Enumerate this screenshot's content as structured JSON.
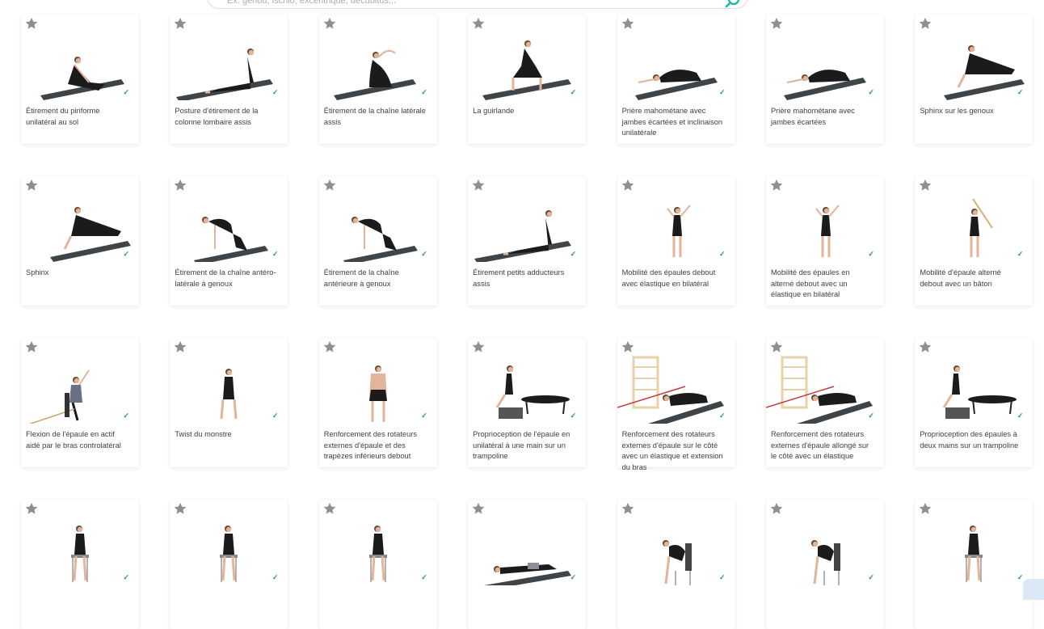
{
  "search": {
    "placeholder": "Ex. genou, ischio, excentrique, décubitus..."
  },
  "check_mark": "✓",
  "exercises": [
    {
      "title": "Étirement du piriforme unilatéral au sol",
      "pose": "mat-lie"
    },
    {
      "title": "Posture d'étirement de la colonne lombaire assis",
      "pose": "mat-sit"
    },
    {
      "title": "Étirement de la chaîne latérale assis",
      "pose": "mat-side"
    },
    {
      "title": "La guirlande",
      "pose": "mat-squat"
    },
    {
      "title": "Prière mahométane avec jambes écartées et inclinaison unilatérale",
      "pose": "mat-child"
    },
    {
      "title": "Prière mahométane avec jambes écartées",
      "pose": "mat-child"
    },
    {
      "title": "Sphinx sur les genoux",
      "pose": "mat-sphinx"
    },
    {
      "title": "Sphinx",
      "pose": "mat-sphinx"
    },
    {
      "title": "Étirement de la chaîne antéro-latérale à genoux",
      "pose": "mat-arch"
    },
    {
      "title": "Étirement de la chaîne antérieure à genoux",
      "pose": "mat-arch"
    },
    {
      "title": "Étirement petits adducteurs assis",
      "pose": "mat-sit"
    },
    {
      "title": "Mobilité des épaules debout avec élastique en bilatéral",
      "pose": "stand-arms"
    },
    {
      "title": "Mobilité des épaules en alterné debout avec un élastique en bilatéral",
      "pose": "stand-arms"
    },
    {
      "title": "Mobilité d'épaule alterné debout avec un bâton",
      "pose": "stand-stick"
    },
    {
      "title": "Flexion de l'épaule en actif aidé par le bras controlatéral",
      "pose": "chair-arm"
    },
    {
      "title": "Twist du monstre",
      "pose": "stand"
    },
    {
      "title": "Renforcement des rotateurs externes d'épaule et des trapèzes inférieurs debout",
      "pose": "stand-back"
    },
    {
      "title": "Proprioception de l'épaule en unilatéral à une main sur un trampoline",
      "pose": "trampoline"
    },
    {
      "title": "Renforcement des rotateurs externes d'épaule sur le côté avec un élastique et extension du bras",
      "pose": "wallbar"
    },
    {
      "title": "Renforcement des rotateurs externes d'épaule allongé sur le côté avec un élastique",
      "pose": "wallbar"
    },
    {
      "title": "Proprioception des épaules à deux mains sur un trampoline",
      "pose": "trampoline"
    },
    {
      "title": "",
      "pose": "chair"
    },
    {
      "title": "",
      "pose": "chair"
    },
    {
      "title": "",
      "pose": "chair"
    },
    {
      "title": "",
      "pose": "mat-plank"
    },
    {
      "title": "",
      "pose": "chair-bend"
    },
    {
      "title": "",
      "pose": "chair-bend"
    },
    {
      "title": "",
      "pose": "chair"
    }
  ],
  "colors": {
    "star": "#8f8f8f",
    "check": "#2e9e44",
    "mat": "#3e4447",
    "figure": "#1b1b1b",
    "skin": "#e2b49a"
  }
}
